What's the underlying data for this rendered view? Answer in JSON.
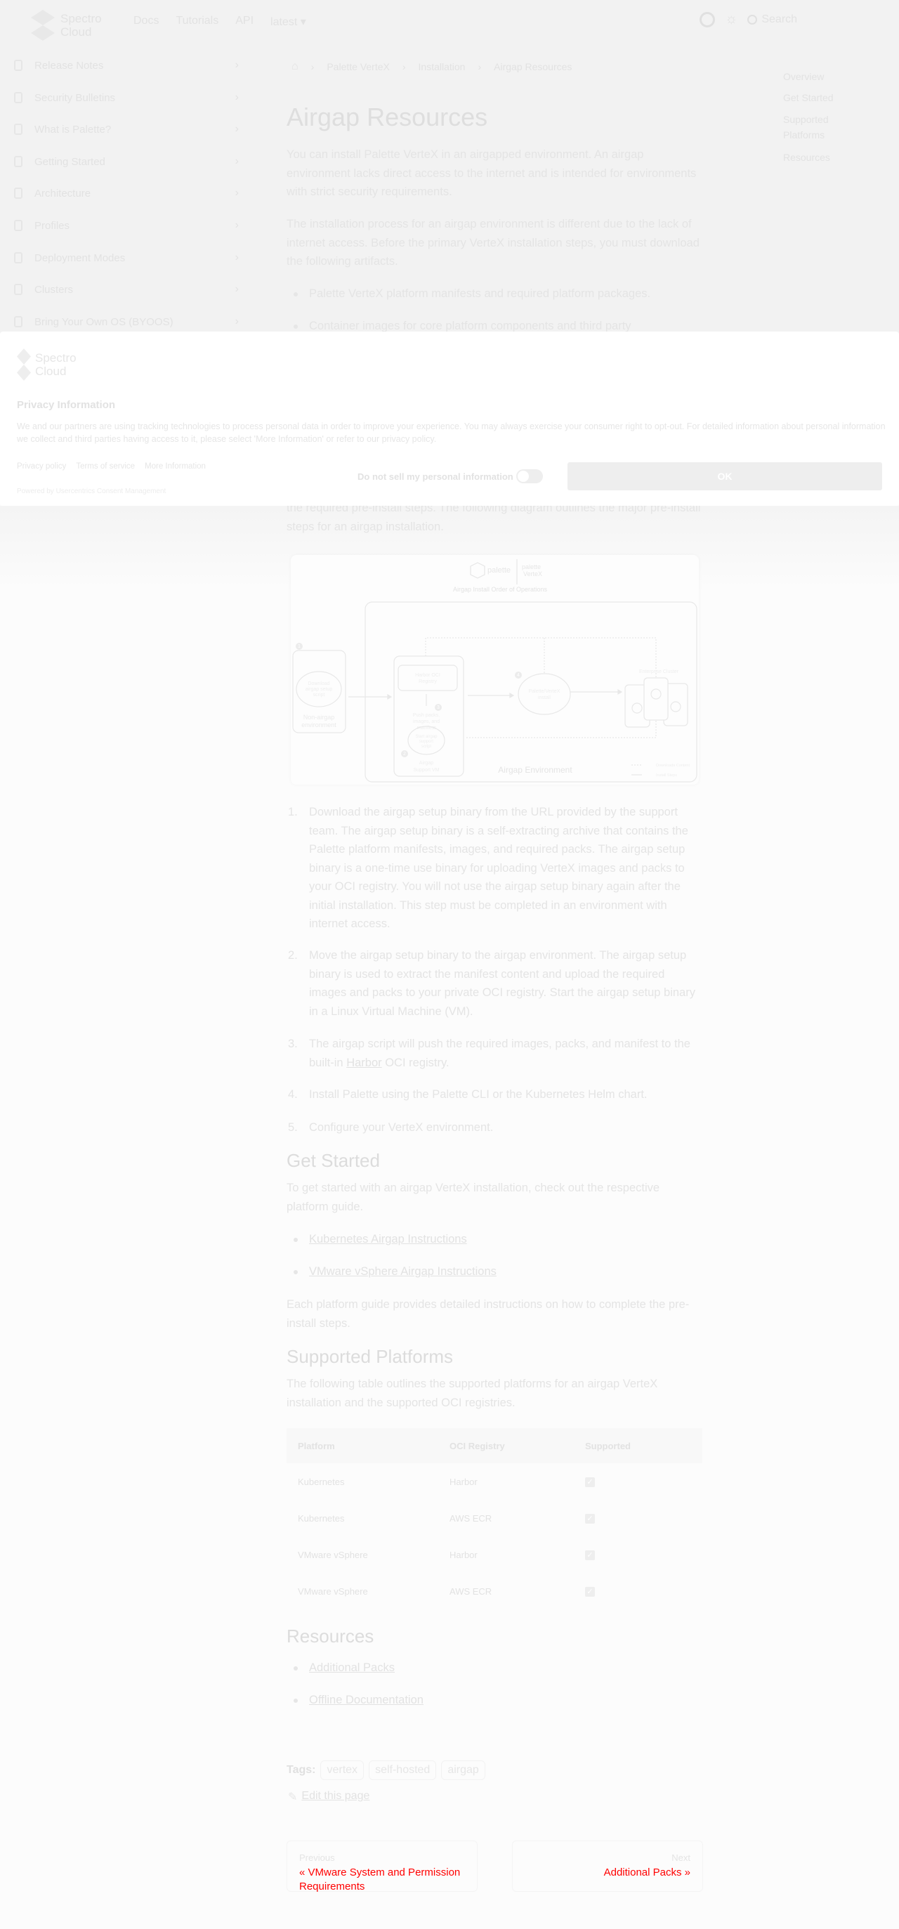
{
  "header": {
    "logo_line1": "Spectro",
    "logo_line2": "Cloud",
    "nav": [
      "Docs",
      "Tutorials",
      "API",
      "latest ▾"
    ],
    "search_label": "Search"
  },
  "sidebar": {
    "items": [
      "Release Notes",
      "Security Bulletins",
      "What is Palette?",
      "Getting Started",
      "Architecture",
      "Profiles",
      "Deployment Modes",
      "Clusters",
      "Bring Your Own OS (BYOOS)"
    ]
  },
  "breadcrumb": [
    "Palette VerteX",
    "Installation",
    "Airgap Resources"
  ],
  "toc": [
    "Overview",
    "Get Started",
    "Supported Platforms",
    "Resources"
  ],
  "page": {
    "title": "Airgap Resources",
    "intro": "You can install Palette VerteX in an airgapped environment. An airgap environment lacks direct access to the internet and is intended for environments with strict security requirements.",
    "intro2": "The installation process for an airgap environment is different due to the lack of internet access. Before the primary VerteX installation steps, you must download the following artifacts.",
    "artifacts": [
      "Palette VerteX platform manifests and required platform packages.",
      "Container images for core platform components and third party"
    ],
    "diagram_intro": "the required pre-install steps. The following diagram outlines the major pre-install steps for an airgap installation.",
    "steps": [
      "Download the airgap setup binary from the URL provided by the support team. The airgap setup binary is a self-extracting archive that contains the Palette platform manifests, images, and required packs. The airgap setup binary is a one-time use binary for uploading VerteX images and packs to your OCI registry. You will not use the airgap setup binary again after the initial installation. This step must be completed in an environment with internet access.",
      "Move the airgap setup binary to the airgap environment. The airgap setup binary is used to extract the manifest content and upload the required images and packs to your private OCI registry. Start the airgap setup binary in a Linux Virtual Machine (VM)."
    ],
    "step3_pre": "The airgap script will push the required images, packs, and manifest to the built-in ",
    "step3_link": "Harbor",
    "step3_post": " OCI registry.",
    "step4": "Install Palette using the Palette CLI or the Kubernetes Helm chart.",
    "step5": "Configure your VerteX environment.",
    "get_started": {
      "heading": "Get Started",
      "text": "To get started with an airgap VerteX installation, check out the respective platform guide.",
      "links": [
        "Kubernetes Airgap Instructions",
        "VMware vSphere Airgap Instructions"
      ],
      "after": "Each platform guide provides detailed instructions on how to complete the pre-install steps."
    },
    "platforms": {
      "heading": "Supported Platforms",
      "text": "The following table outlines the supported platforms for an airgap VerteX installation and the supported OCI registries.",
      "columns": [
        "Platform",
        "OCI Registry",
        "Supported"
      ],
      "rows": [
        [
          "Kubernetes",
          "Harbor",
          "✓"
        ],
        [
          "Kubernetes",
          "AWS ECR",
          "✓"
        ],
        [
          "VMware vSphere",
          "Harbor",
          "✓"
        ],
        [
          "VMware vSphere",
          "AWS ECR",
          "✓"
        ]
      ]
    },
    "resources": {
      "heading": "Resources",
      "links": [
        "Additional Packs",
        "Offline Documentation"
      ]
    },
    "tags_label": "Tags:",
    "tags": [
      "vertex",
      "self-hosted",
      "airgap"
    ],
    "edit": "Edit this page",
    "prev_label": "Previous",
    "prev_title": "« VMware System and Permission Requirements",
    "next_label": "Next",
    "next_title": "Additional Packs »"
  },
  "diagram": {
    "brand1": "palette",
    "brand2a": "palette",
    "brand2b": "VerteX",
    "title": "Airgap Install Order of Operations",
    "download": [
      "Download",
      "airgap setup",
      "script"
    ],
    "nonairgap": [
      "Non-airgap",
      "environment"
    ],
    "harbor": [
      "Harbor OCI",
      "Registry"
    ],
    "push": [
      "Push packs,",
      "images, and",
      "manifest"
    ],
    "start": [
      "Start airgap",
      "support",
      "script"
    ],
    "vm": [
      "Airgap",
      "Support VM"
    ],
    "install": [
      "Palette/VerteX",
      "install"
    ],
    "cluster": "Enterprise Cluster",
    "env": "Airgap Environment",
    "legend1": "Downloads Content",
    "legend2": "Install Steps",
    "nums": [
      "1",
      "2",
      "3",
      "4"
    ]
  },
  "banner": {
    "logo_line1": "Spectro",
    "logo_line2": "Cloud",
    "title": "Privacy Information",
    "text": "We and our partners are using tracking technologies to process personal data in order to improve your experience. You may always exercise your consumer right to opt-out. For detailed information about personal information we collect and third parties having access to it, please select 'More Information' or refer to our privacy policy.",
    "links": [
      "Privacy policy",
      "Terms of service",
      "More Information"
    ],
    "powered": "Powered by Usercentrics Consent Management",
    "dns": "Do not sell my personal information",
    "ok": "OK"
  }
}
